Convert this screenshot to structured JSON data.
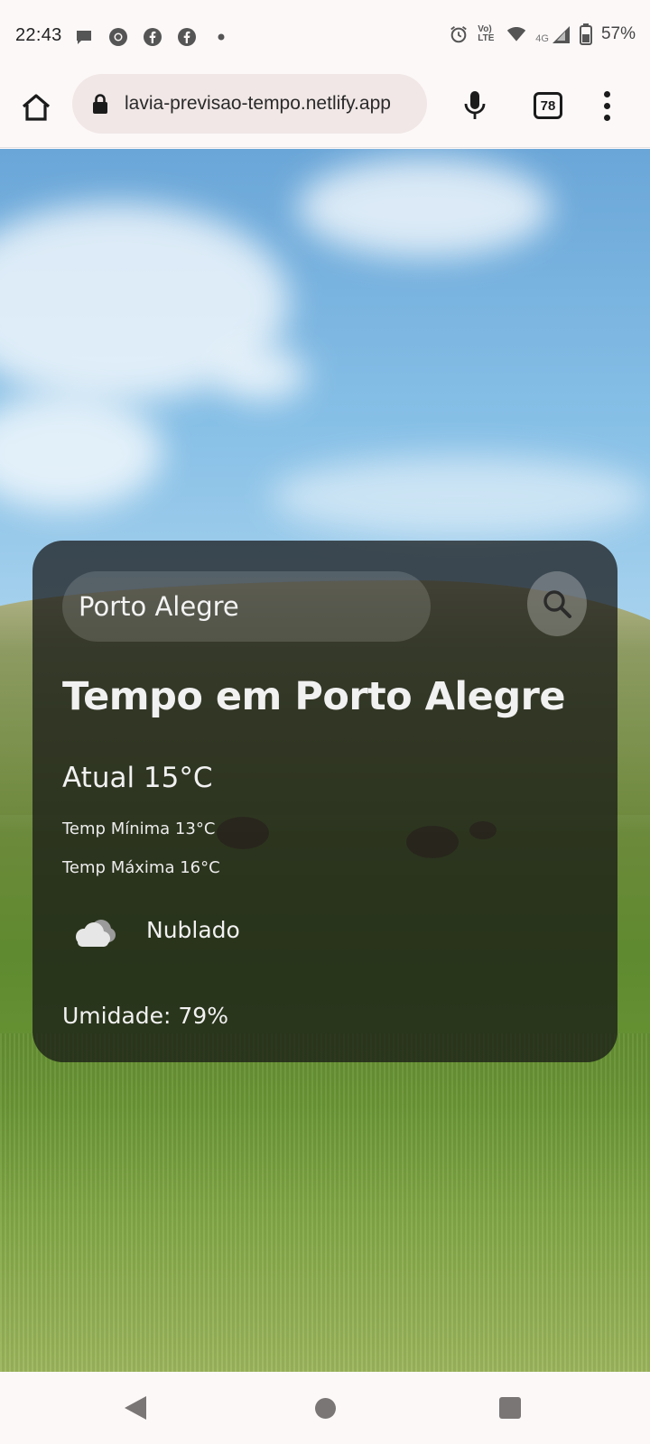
{
  "status_bar": {
    "time": "22:43",
    "battery": "57%",
    "network": "4G",
    "volte": "Vo) LTE",
    "left_icons": [
      "chat-bubble-icon",
      "chrome-icon",
      "facebook-icon",
      "facebook-icon",
      "dot-icon"
    ],
    "right_icons": [
      "alarm-icon",
      "volte-icon",
      "wifi-icon",
      "signal-icon",
      "battery-icon"
    ]
  },
  "browser": {
    "url": "lavia-previsao-tempo.netlify.app",
    "tab_count": "78"
  },
  "weather": {
    "search_value": "Porto Alegre",
    "title": "Tempo em Porto Alegre",
    "current": "Atual 15°C",
    "min": "Temp Mínima 13°C",
    "max": "Temp Máxima 16°C",
    "condition": "Nublado",
    "condition_icon": "cloud-icon",
    "humidity": "Umidade: 79%"
  },
  "colors": {
    "card_bg": "#141414",
    "text": "#f1f1f1",
    "sky": "#86bfe6",
    "grass": "#5f8a2f"
  }
}
